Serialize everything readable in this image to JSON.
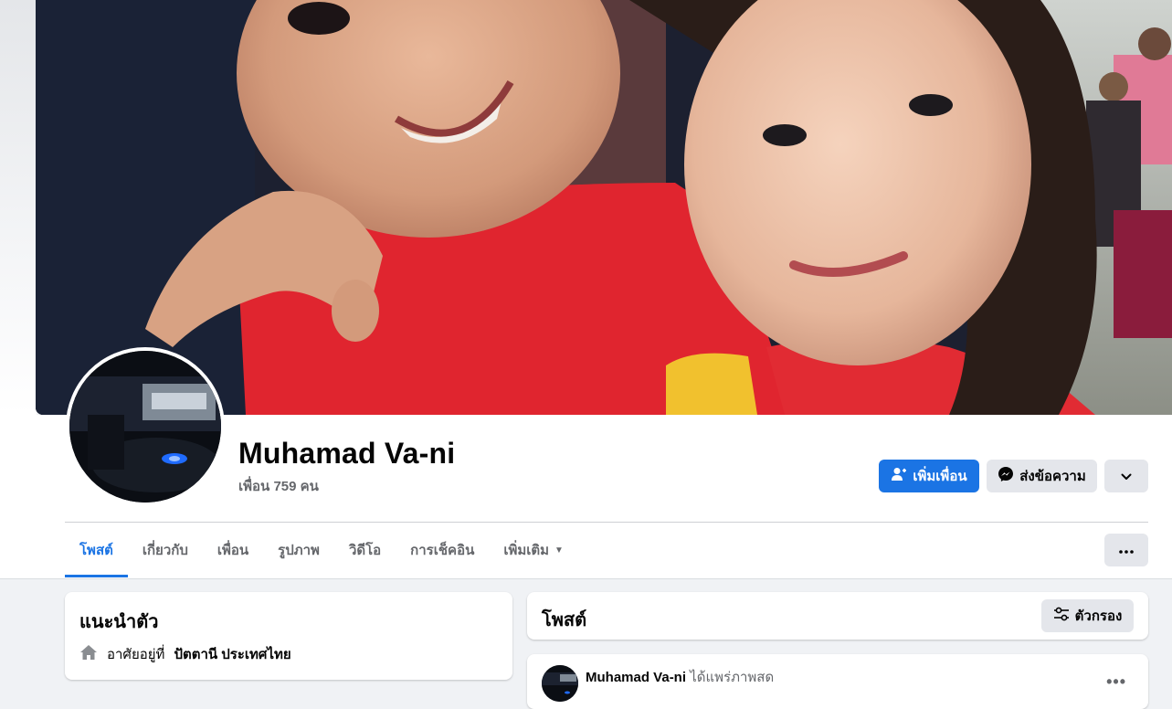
{
  "profile": {
    "name": "Muhamad Va-ni",
    "friends_count": "เพื่อน 759 คน"
  },
  "actions": {
    "add_friend": "เพิ่มเพื่อน",
    "message": "ส่งข้อความ"
  },
  "tabs": [
    {
      "label": "โพสต์"
    },
    {
      "label": "เกี่ยวกับ"
    },
    {
      "label": "เพื่อน"
    },
    {
      "label": "รูปภาพ"
    },
    {
      "label": "วิดีโอ"
    },
    {
      "label": "การเช็คอิน"
    },
    {
      "label": "เพิ่มเติม"
    }
  ],
  "intro": {
    "title": "แนะนำตัว",
    "lives_in_prefix": "อาศัยอยู่ที่",
    "lives_in_place": "ปัตตานี ประเทศไทย"
  },
  "posts": {
    "title": "โพสต์",
    "filter": "ตัวกรอง",
    "first_post": {
      "author": "Muhamad Va-ni",
      "action": "ได้แพร่ภาพสด"
    }
  },
  "colors": {
    "accent": "#1b74e4",
    "page_bg": "#f0f2f5"
  }
}
